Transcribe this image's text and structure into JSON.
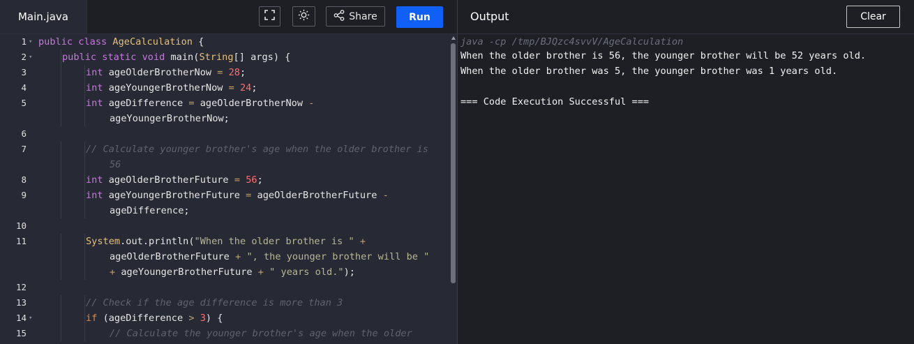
{
  "editor": {
    "file_tab": "Main.java",
    "share_label": "Share",
    "run_label": "Run",
    "icons": {
      "fullscreen": "fullscreen-icon",
      "theme": "sun-icon",
      "share": "share-icon"
    },
    "lines": [
      {
        "num": "1",
        "fold": true,
        "indent": 0,
        "tokens": [
          {
            "t": "public class ",
            "c": "kw"
          },
          {
            "t": "AgeCalculation",
            "c": "ty"
          },
          {
            "t": " {",
            "c": "id"
          }
        ]
      },
      {
        "num": "2",
        "fold": true,
        "indent": 1,
        "tokens": [
          {
            "t": "public static void ",
            "c": "kw"
          },
          {
            "t": "main",
            "c": "fn"
          },
          {
            "t": "(",
            "c": "id"
          },
          {
            "t": "String",
            "c": "typ"
          },
          {
            "t": "[] args) {",
            "c": "id"
          }
        ]
      },
      {
        "num": "3",
        "indent": 2,
        "tokens": [
          {
            "t": "int ",
            "c": "kw"
          },
          {
            "t": "ageOlderBrotherNow ",
            "c": "id"
          },
          {
            "t": "= ",
            "c": "op"
          },
          {
            "t": "28",
            "c": "num"
          },
          {
            "t": ";",
            "c": "id"
          }
        ]
      },
      {
        "num": "4",
        "indent": 2,
        "tokens": [
          {
            "t": "int ",
            "c": "kw"
          },
          {
            "t": "ageYoungerBrotherNow ",
            "c": "id"
          },
          {
            "t": "= ",
            "c": "op"
          },
          {
            "t": "24",
            "c": "num"
          },
          {
            "t": ";",
            "c": "id"
          }
        ]
      },
      {
        "num": "5",
        "indent": 2,
        "tokens": [
          {
            "t": "int ",
            "c": "kw"
          },
          {
            "t": "ageDifference ",
            "c": "id"
          },
          {
            "t": "= ",
            "c": "op"
          },
          {
            "t": "ageOlderBrotherNow ",
            "c": "id"
          },
          {
            "t": "-",
            "c": "op"
          }
        ]
      },
      {
        "num": "",
        "indent": 3,
        "tokens": [
          {
            "t": "ageYoungerBrotherNow;",
            "c": "id"
          }
        ]
      },
      {
        "num": "6",
        "indent": 0,
        "tokens": []
      },
      {
        "num": "7",
        "indent": 2,
        "tokens": [
          {
            "t": "// Calculate younger brother's age when the older brother is",
            "c": "cm"
          }
        ]
      },
      {
        "num": "",
        "indent": 3,
        "tokens": [
          {
            "t": "56",
            "c": "cm"
          }
        ]
      },
      {
        "num": "8",
        "indent": 2,
        "tokens": [
          {
            "t": "int ",
            "c": "kw"
          },
          {
            "t": "ageOlderBrotherFuture ",
            "c": "id"
          },
          {
            "t": "= ",
            "c": "op"
          },
          {
            "t": "56",
            "c": "num"
          },
          {
            "t": ";",
            "c": "id"
          }
        ]
      },
      {
        "num": "9",
        "indent": 2,
        "tokens": [
          {
            "t": "int ",
            "c": "kw"
          },
          {
            "t": "ageYoungerBrotherFuture ",
            "c": "id"
          },
          {
            "t": "= ",
            "c": "op"
          },
          {
            "t": "ageOlderBrotherFuture ",
            "c": "id"
          },
          {
            "t": "-",
            "c": "op"
          }
        ]
      },
      {
        "num": "",
        "indent": 3,
        "tokens": [
          {
            "t": "ageDifference;",
            "c": "id"
          }
        ]
      },
      {
        "num": "10",
        "indent": 0,
        "tokens": []
      },
      {
        "num": "11",
        "indent": 2,
        "tokens": [
          {
            "t": "System",
            "c": "typ"
          },
          {
            "t": ".out.",
            "c": "id"
          },
          {
            "t": "println",
            "c": "fn"
          },
          {
            "t": "(",
            "c": "id"
          },
          {
            "t": "\"When the older brother is \"",
            "c": "str"
          },
          {
            "t": " +",
            "c": "op"
          }
        ]
      },
      {
        "num": "",
        "indent": 3,
        "tokens": [
          {
            "t": "ageOlderBrotherFuture ",
            "c": "id"
          },
          {
            "t": "+ ",
            "c": "op"
          },
          {
            "t": "\", the younger brother will be \"",
            "c": "str"
          }
        ]
      },
      {
        "num": "",
        "indent": 3,
        "tokens": [
          {
            "t": "+ ",
            "c": "op"
          },
          {
            "t": "ageYoungerBrotherFuture ",
            "c": "id"
          },
          {
            "t": "+ ",
            "c": "op"
          },
          {
            "t": "\" years old.\"",
            "c": "str"
          },
          {
            "t": ");",
            "c": "id"
          }
        ]
      },
      {
        "num": "12",
        "indent": 0,
        "tokens": []
      },
      {
        "num": "13",
        "indent": 2,
        "tokens": [
          {
            "t": "// Check if the age difference is more than 3",
            "c": "cm"
          }
        ]
      },
      {
        "num": "14",
        "fold": true,
        "indent": 2,
        "tokens": [
          {
            "t": "if ",
            "c": "kw2"
          },
          {
            "t": "(ageDifference ",
            "c": "id"
          },
          {
            "t": "> ",
            "c": "op"
          },
          {
            "t": "3",
            "c": "num"
          },
          {
            "t": ") {",
            "c": "id"
          }
        ]
      },
      {
        "num": "15",
        "indent": 3,
        "tokens": [
          {
            "t": "// Calculate the younger brother's age when the older",
            "c": "cm"
          }
        ]
      }
    ]
  },
  "output": {
    "title": "Output",
    "clear_label": "Clear",
    "command": "java -cp /tmp/BJQzc4svvV/AgeCalculation",
    "lines": [
      "When the older brother is 56, the younger brother will be 52 years old.",
      "When the older brother was 5, the younger brother was 1 years old.",
      "",
      "=== Code Execution Successful ==="
    ]
  }
}
